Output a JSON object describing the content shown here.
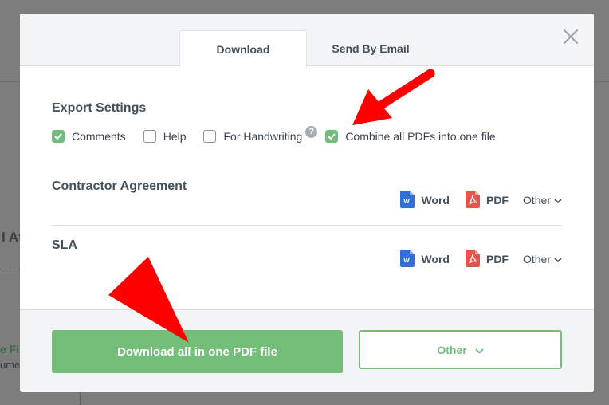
{
  "background": {
    "fragments": [
      "l At",
      "e Fil",
      "umen"
    ]
  },
  "dialog": {
    "tabs": [
      {
        "label": "Download",
        "active": true
      },
      {
        "label": "Send By Email",
        "active": false
      }
    ],
    "close_icon": "close-icon",
    "export_settings": {
      "title": "Export Settings",
      "options": [
        {
          "label": "Comments",
          "checked": true
        },
        {
          "label": "Help",
          "checked": false
        },
        {
          "label": "For Handwriting",
          "checked": false,
          "help": "?"
        },
        {
          "label": "Combine all PDFs into one file",
          "checked": true
        }
      ]
    },
    "documents": [
      {
        "name": "Contractor Agreement",
        "word_label": "Word",
        "pdf_label": "PDF",
        "other_label": "Other"
      },
      {
        "name": "SLA",
        "word_label": "Word",
        "pdf_label": "PDF",
        "other_label": "Other"
      }
    ],
    "footer": {
      "primary_label": "Download all in one PDF file",
      "secondary_label": "Other"
    }
  },
  "colors": {
    "accent_green": "#73bf79",
    "annotation_red": "#ff0000",
    "word_blue": "#2f6fd6",
    "pdf_red": "#e2574c"
  }
}
